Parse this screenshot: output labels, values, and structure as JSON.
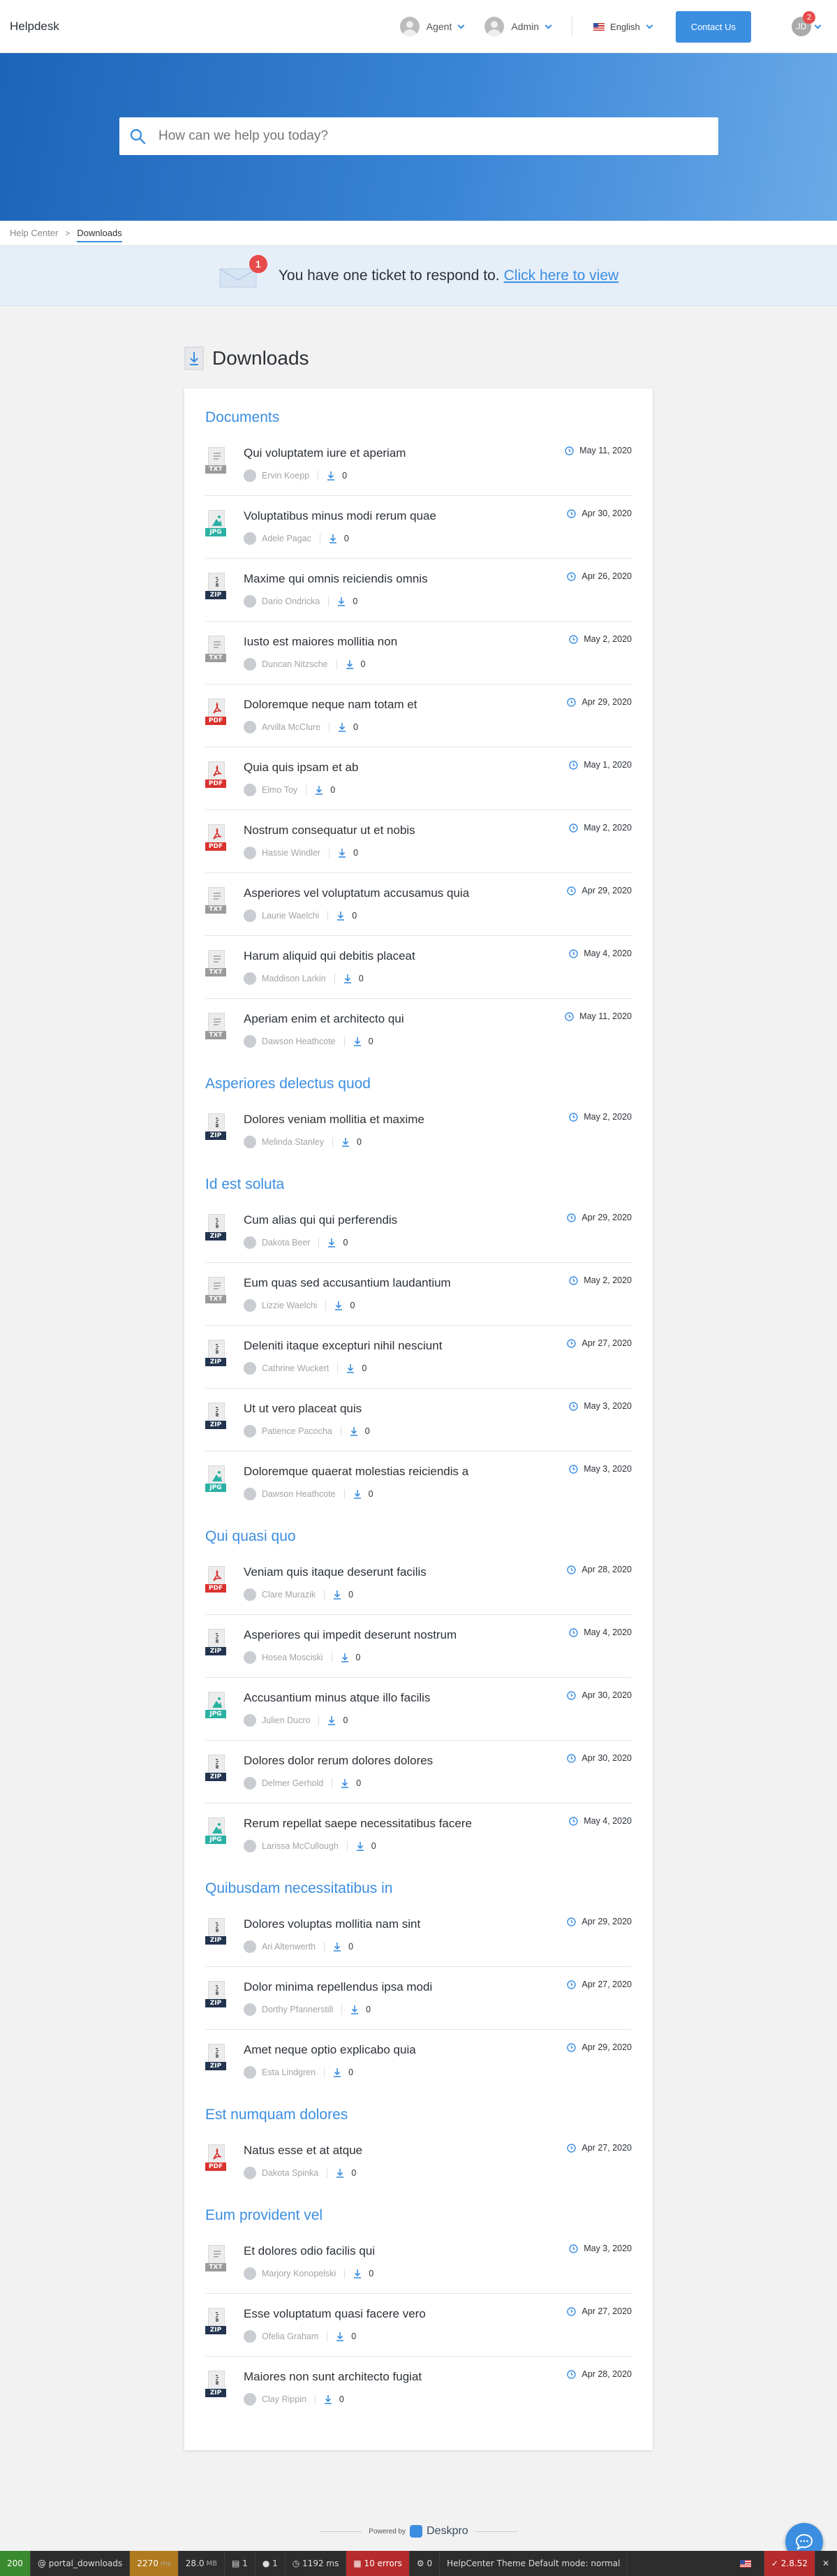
{
  "header": {
    "brand": "Helpdesk",
    "agent_label": "Agent",
    "admin_label": "Admin",
    "language_label": "English",
    "contact_label": "Contact Us",
    "user_initials": "JD",
    "user_badge": "2"
  },
  "search": {
    "placeholder": "How can we help you today?"
  },
  "breadcrumb": {
    "home": "Help Center",
    "current": "Downloads"
  },
  "notice": {
    "badge": "1",
    "text": "You have one ticket to respond to.",
    "link": "Click here to view"
  },
  "page": {
    "title": "Downloads"
  },
  "categories": [
    {
      "title": "Documents",
      "items": [
        {
          "title": "Qui voluptatem iure et aperiam",
          "author": "Ervin Koepp",
          "count": "0",
          "date": "May 11, 2020",
          "type": "TXT"
        },
        {
          "title": "Voluptatibus minus modi rerum quae",
          "author": "Adele Pagac",
          "count": "0",
          "date": "Apr 30, 2020",
          "type": "JPG"
        },
        {
          "title": "Maxime qui omnis reiciendis omnis",
          "author": "Dario Ondricka",
          "count": "0",
          "date": "Apr 26, 2020",
          "type": "ZIP"
        },
        {
          "title": "Iusto est maiores mollitia non",
          "author": "Duncan Nitzsche",
          "count": "0",
          "date": "May 2, 2020",
          "type": "TXT"
        },
        {
          "title": "Doloremque neque nam totam et",
          "author": "Arvilla McClure",
          "count": "0",
          "date": "Apr 29, 2020",
          "type": "PDF"
        },
        {
          "title": "Quia quis ipsam et ab",
          "author": "Elmo Toy",
          "count": "0",
          "date": "May 1, 2020",
          "type": "PDF"
        },
        {
          "title": "Nostrum consequatur ut et nobis",
          "author": "Hassie Windler",
          "count": "0",
          "date": "May 2, 2020",
          "type": "PDF"
        },
        {
          "title": "Asperiores vel voluptatum accusamus quia",
          "author": "Laurie Waelchi",
          "count": "0",
          "date": "Apr 29, 2020",
          "type": "TXT"
        },
        {
          "title": "Harum aliquid qui debitis placeat",
          "author": "Maddison Larkin",
          "count": "0",
          "date": "May 4, 2020",
          "type": "TXT"
        },
        {
          "title": "Aperiam enim et architecto qui",
          "author": "Dawson Heathcote",
          "count": "0",
          "date": "May 11, 2020",
          "type": "TXT"
        }
      ]
    },
    {
      "title": "Asperiores delectus quod",
      "items": [
        {
          "title": "Dolores veniam mollitia et maxime",
          "author": "Melinda Stanley",
          "count": "0",
          "date": "May 2, 2020",
          "type": "ZIP"
        }
      ]
    },
    {
      "title": "Id est soluta",
      "items": [
        {
          "title": "Cum alias qui qui perferendis",
          "author": "Dakota Beer",
          "count": "0",
          "date": "Apr 29, 2020",
          "type": "ZIP"
        },
        {
          "title": "Eum quas sed accusantium laudantium",
          "author": "Lizzie Waelchi",
          "count": "0",
          "date": "May 2, 2020",
          "type": "TXT"
        },
        {
          "title": "Deleniti itaque excepturi nihil nesciunt",
          "author": "Cathrine Wuckert",
          "count": "0",
          "date": "Apr 27, 2020",
          "type": "ZIP"
        },
        {
          "title": "Ut ut vero placeat quis",
          "author": "Patience Pacocha",
          "count": "0",
          "date": "May 3, 2020",
          "type": "ZIP"
        },
        {
          "title": "Doloremque quaerat molestias reiciendis a",
          "author": "Dawson Heathcote",
          "count": "0",
          "date": "May 3, 2020",
          "type": "JPG"
        }
      ]
    },
    {
      "title": "Qui quasi quo",
      "items": [
        {
          "title": "Veniam quis itaque deserunt facilis",
          "author": "Clare Murazik",
          "count": "0",
          "date": "Apr 28, 2020",
          "type": "PDF"
        },
        {
          "title": "Asperiores qui impedit deserunt nostrum",
          "author": "Hosea Mosciski",
          "count": "0",
          "date": "May 4, 2020",
          "type": "ZIP"
        },
        {
          "title": "Accusantium minus atque illo facilis",
          "author": "Julien Ducro",
          "count": "0",
          "date": "Apr 30, 2020",
          "type": "JPG"
        },
        {
          "title": "Dolores dolor rerum dolores dolores",
          "author": "Delmer Gerhold",
          "count": "0",
          "date": "Apr 30, 2020",
          "type": "ZIP"
        },
        {
          "title": "Rerum repellat saepe necessitatibus facere",
          "author": "Larissa McCullough",
          "count": "0",
          "date": "May 4, 2020",
          "type": "JPG"
        }
      ]
    },
    {
      "title": "Quibusdam necessitatibus in",
      "items": [
        {
          "title": "Dolores voluptas mollitia nam sint",
          "author": "Ari Altenwerth",
          "count": "0",
          "date": "Apr 29, 2020",
          "type": "ZIP"
        },
        {
          "title": "Dolor minima repellendus ipsa modi",
          "author": "Dorthy Pfannerstill",
          "count": "0",
          "date": "Apr 27, 2020",
          "type": "ZIP"
        },
        {
          "title": "Amet neque optio explicabo quia",
          "author": "Esta Lindgren",
          "count": "0",
          "date": "Apr 29, 2020",
          "type": "ZIP"
        }
      ]
    },
    {
      "title": "Est numquam dolores",
      "items": [
        {
          "title": "Natus esse et at atque",
          "author": "Dakota Spinka",
          "count": "0",
          "date": "Apr 27, 2020",
          "type": "PDF"
        }
      ]
    },
    {
      "title": "Eum provident vel",
      "items": [
        {
          "title": "Et dolores odio facilis qui",
          "author": "Marjory Konopelski",
          "count": "0",
          "date": "May 3, 2020",
          "type": "TXT"
        },
        {
          "title": "Esse voluptatum quasi facere vero",
          "author": "Ofelia Graham",
          "count": "0",
          "date": "Apr 27, 2020",
          "type": "ZIP"
        },
        {
          "title": "Maiores non sunt architecto fugiat",
          "author": "Clay Rippin",
          "count": "0",
          "date": "Apr 28, 2020",
          "type": "ZIP"
        }
      ]
    }
  ],
  "footer": {
    "powered_by": "Powered by",
    "brand": "Deskpro"
  },
  "debugbar": {
    "status": "200",
    "route": "@ portal_downloads",
    "time": "2270",
    "time_unit": "ms",
    "memory": "28.0",
    "memory_unit": "MB",
    "forms": "1",
    "user": "1",
    "render_time": "1192 ms",
    "errors": "10 errors",
    "cache": "0",
    "theme": "HelpCenter Theme Default mode: normal",
    "version": "2.8.52"
  },
  "colors": {
    "accent": "#3b8ee0",
    "pdf": "#d9322e",
    "zip": "#23344f",
    "jpg": "#2bb1a3",
    "txt": "#9a9a9a",
    "badge": "#e84b4b"
  }
}
